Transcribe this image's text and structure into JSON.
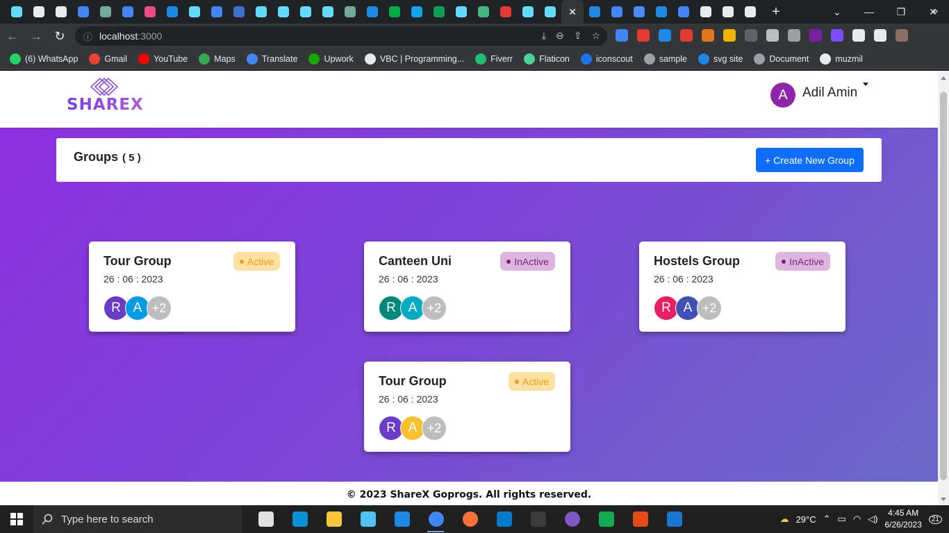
{
  "browser": {
    "tabs": [
      {
        "icon": "react-icon",
        "color": "#61dafb"
      },
      {
        "icon": "chart-icon",
        "color": "#e8eaed"
      },
      {
        "icon": "chart-icon",
        "color": "#e8eaed"
      },
      {
        "icon": "google-icon",
        "color": "#4285f4"
      },
      {
        "icon": "openai-icon",
        "color": "#74aa9c"
      },
      {
        "icon": "google-icon",
        "color": "#4285f4"
      },
      {
        "icon": "dribbble-icon",
        "color": "#ea4c89"
      },
      {
        "icon": "mui-icon",
        "color": "#1e88e5"
      },
      {
        "icon": "react-icon",
        "color": "#61dafb"
      },
      {
        "icon": "google-icon",
        "color": "#4285f4"
      },
      {
        "icon": "mdb-icon",
        "color": "#3b71ca"
      },
      {
        "icon": "bootstrap-react-icon",
        "color": "#61dafb"
      },
      {
        "icon": "react-icon",
        "color": "#61dafb"
      },
      {
        "icon": "react-icon",
        "color": "#61dafb"
      },
      {
        "icon": "react-icon",
        "color": "#61dafb"
      },
      {
        "icon": "openai-icon",
        "color": "#74aa9c"
      },
      {
        "icon": "mui-icon",
        "color": "#1e88e5"
      },
      {
        "icon": "meet-icon",
        "color": "#00ac47"
      },
      {
        "icon": "pin-icon",
        "color": "#0ea5e9"
      },
      {
        "icon": "webflow-icon",
        "color": "#0f9d58"
      },
      {
        "icon": "bootstrap-react-icon",
        "color": "#61dafb"
      },
      {
        "icon": "vue-icon",
        "color": "#41b883"
      },
      {
        "icon": "m-icon",
        "color": "#e53935"
      },
      {
        "icon": "react-icon",
        "color": "#61dafb"
      },
      {
        "icon": "react-icon",
        "color": "#61dafb"
      },
      {
        "icon": "active-tab",
        "color": "#35363a"
      },
      {
        "icon": "mui-icon",
        "color": "#1e88e5"
      },
      {
        "icon": "google-icon",
        "color": "#4285f4"
      },
      {
        "icon": "plus-blue-icon",
        "color": "#4a8af4"
      },
      {
        "icon": "mui-icon",
        "color": "#1e88e5"
      },
      {
        "icon": "google-icon",
        "color": "#4285f4"
      },
      {
        "icon": "github-icon",
        "color": "#e8eaed"
      },
      {
        "icon": "chrome-icon",
        "color": "#e8eaed"
      },
      {
        "icon": "chrome-icon",
        "color": "#e8eaed"
      }
    ],
    "active_tab_close": "✕",
    "new_tab": "+",
    "window_controls": {
      "chevron": "⌄",
      "minimize": "—",
      "restore": "❐",
      "close": "✕"
    },
    "nav": {
      "back": "←",
      "forward": "→",
      "reload": "↻"
    },
    "address": {
      "host": "localhost",
      "port": ":3000"
    },
    "omnibox_icons": [
      "⤓",
      "⊖",
      "⇪",
      "☆"
    ],
    "extensions": [
      "#4285f4",
      "#e53935",
      "#1e88e5",
      "#e53935",
      "#e2761b",
      "#f4b400",
      "#5f6368",
      "#bdbdbd",
      "#9aa0a6",
      "#7b1fa2",
      "#7c4dff",
      "#e8eaed",
      "#e8eaed",
      "#8d6e63"
    ],
    "bookmarks": [
      {
        "label": "(6) WhatsApp",
        "color": "#25d366"
      },
      {
        "label": "Gmail",
        "color": "#ea4335"
      },
      {
        "label": "YouTube",
        "color": "#ff0000"
      },
      {
        "label": "Maps",
        "color": "#34a853"
      },
      {
        "label": "Translate",
        "color": "#4285f4"
      },
      {
        "label": "Upwork",
        "color": "#14a800"
      },
      {
        "label": "VBC | Programming...",
        "color": "#e8eaed"
      },
      {
        "label": "Fiverr",
        "color": "#1dbf73"
      },
      {
        "label": "Flaticon",
        "color": "#4ad295"
      },
      {
        "label": "iconscout",
        "color": "#1a73e8"
      },
      {
        "label": "sample",
        "color": "#9aa0a6"
      },
      {
        "label": "svg site",
        "color": "#1e88e5"
      },
      {
        "label": "Document",
        "color": "#9aa0a6"
      },
      {
        "label": "muzmil",
        "color": "#e8eaed"
      }
    ],
    "bookmarks_more": "»"
  },
  "app": {
    "brand": "SHAREX",
    "user": {
      "initial": "A",
      "name": "Adil Amin",
      "avatar_color": "#8e24aa"
    },
    "groups_bar": {
      "title": "Groups",
      "count": "( 5 )",
      "create_label": "+ Create New Group"
    },
    "groups": [
      {
        "title": "Tour Group",
        "date": "26 : 06 : 2023",
        "status": "Active",
        "status_type": "active",
        "members": [
          {
            "initial": "R",
            "color": "#6a3cc7"
          },
          {
            "initial": "A",
            "color": "#039be5"
          }
        ],
        "more": "+2"
      },
      {
        "title": "Canteen Uni",
        "date": "26 : 06 : 2023",
        "status": "InActive",
        "status_type": "inactive",
        "members": [
          {
            "initial": "R",
            "color": "#00897b"
          },
          {
            "initial": "A",
            "color": "#00acc1"
          }
        ],
        "more": "+2"
      },
      {
        "title": "Hostels Group",
        "date": "26 : 06 : 2023",
        "status": "InActive",
        "status_type": "inactive",
        "members": [
          {
            "initial": "R",
            "color": "#e91e63"
          },
          {
            "initial": "A",
            "color": "#3f51b5"
          }
        ],
        "more": "+2"
      },
      {
        "title": "Tour Group",
        "date": "26 : 06 : 2023",
        "status": "Active",
        "status_type": "active",
        "members": [
          {
            "initial": "R",
            "color": "#6a3cc7"
          },
          {
            "initial": "A",
            "color": "#fbc02d"
          }
        ],
        "more": "+2"
      }
    ],
    "footer": "© 2023 ShareX Goprogs. All rights reserved."
  },
  "taskbar": {
    "search_placeholder": "Type here to search",
    "apps": [
      {
        "name": "task-view",
        "color": "#e0e0e0",
        "running": false
      },
      {
        "name": "edge",
        "color": "#0c8fd6",
        "running": false
      },
      {
        "name": "file-explorer",
        "color": "#f8c53a",
        "running": false
      },
      {
        "name": "store",
        "color": "#4fc3f7",
        "running": false
      },
      {
        "name": "mail",
        "color": "#1e88e5",
        "running": false
      },
      {
        "name": "chrome",
        "color": "#4285f4",
        "running": true
      },
      {
        "name": "firefox",
        "color": "#ff7139",
        "running": false
      },
      {
        "name": "vscode",
        "color": "#007acc",
        "running": false
      },
      {
        "name": "terminal",
        "color": "#3c3c3c",
        "running": false
      },
      {
        "name": "app-circle",
        "color": "#7e57c2",
        "running": false
      },
      {
        "name": "mongodb",
        "color": "#13aa52",
        "running": false
      },
      {
        "name": "git-app",
        "color": "#e64a19",
        "running": false
      },
      {
        "name": "photos",
        "color": "#1976d2",
        "running": false
      }
    ],
    "weather": "29°C",
    "time": "4:45 AM",
    "date": "6/26/2023",
    "notification_count": "21"
  }
}
